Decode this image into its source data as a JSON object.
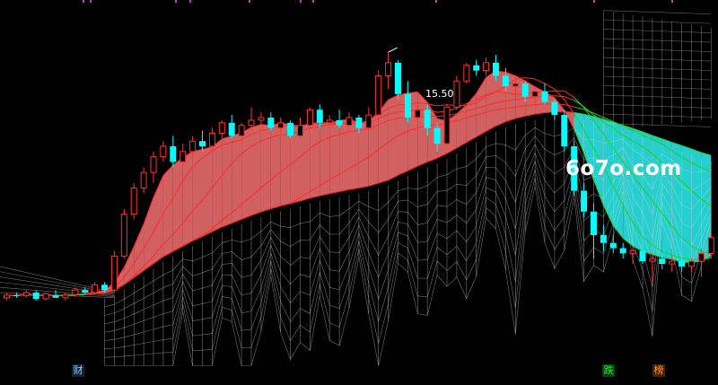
{
  "colors": {
    "background": "#000000",
    "up_candle": "#ff3232",
    "down_candle": "#00ffff",
    "ribbon_up": "#e86a6a",
    "ribbon_down": "#29e6e6",
    "ma_bull": "#ff2a2a",
    "ma_bear": "#1fd11f",
    "mesh": "#d9d9d9"
  },
  "watermark": "6o7o.com",
  "peak_label": "15.50",
  "tags": {
    "cai": "财",
    "die": "跌",
    "bang": "榜"
  },
  "chart_data": {
    "type": "candlestick",
    "title": "",
    "y_scale": {
      "price_at_top": 16.5,
      "price_at_bottom": 9.2
    },
    "annotation": {
      "text": "15.50",
      "index": 39,
      "price": 15.5
    },
    "candles": [
      [
        10.8,
        10.9,
        10.75,
        10.85
      ],
      [
        10.85,
        10.9,
        10.8,
        10.84
      ],
      [
        10.84,
        10.95,
        10.8,
        10.9
      ],
      [
        10.9,
        10.95,
        10.75,
        10.78
      ],
      [
        10.78,
        10.9,
        10.75,
        10.88
      ],
      [
        10.85,
        10.95,
        10.8,
        10.8
      ],
      [
        10.8,
        10.9,
        10.75,
        10.86
      ],
      [
        10.86,
        11.0,
        10.82,
        10.95
      ],
      [
        10.95,
        11.0,
        10.88,
        10.9
      ],
      [
        10.9,
        11.1,
        10.88,
        11.05
      ],
      [
        11.05,
        11.1,
        10.9,
        10.95
      ],
      [
        10.95,
        11.7,
        10.9,
        11.6
      ],
      [
        11.6,
        12.5,
        11.55,
        12.4
      ],
      [
        12.4,
        13.0,
        12.3,
        12.9
      ],
      [
        12.9,
        13.3,
        12.8,
        13.2
      ],
      [
        13.2,
        13.6,
        13.0,
        13.5
      ],
      [
        13.5,
        13.8,
        13.4,
        13.7
      ],
      [
        13.7,
        13.9,
        13.3,
        13.4
      ],
      [
        13.4,
        13.75,
        13.3,
        13.6
      ],
      [
        13.6,
        13.9,
        13.5,
        13.8
      ],
      [
        13.8,
        14.0,
        13.6,
        13.7
      ],
      [
        13.7,
        14.05,
        13.6,
        13.95
      ],
      [
        13.95,
        14.2,
        13.85,
        14.15
      ],
      [
        14.15,
        14.3,
        13.85,
        13.9
      ],
      [
        13.9,
        14.15,
        13.8,
        14.1
      ],
      [
        14.1,
        14.45,
        14.0,
        14.2
      ],
      [
        14.2,
        14.35,
        14.05,
        14.25
      ],
      [
        14.25,
        14.35,
        14.0,
        14.05
      ],
      [
        14.05,
        14.25,
        13.95,
        14.15
      ],
      [
        14.15,
        14.2,
        13.85,
        13.9
      ],
      [
        13.9,
        14.25,
        13.85,
        14.1
      ],
      [
        14.1,
        14.45,
        14.05,
        14.4
      ],
      [
        14.4,
        14.5,
        14.05,
        14.15
      ],
      [
        14.15,
        14.3,
        14.0,
        14.2
      ],
      [
        14.2,
        14.4,
        14.05,
        14.1
      ],
      [
        14.1,
        14.35,
        14.0,
        14.25
      ],
      [
        14.25,
        14.3,
        13.95,
        14.05
      ],
      [
        14.05,
        14.45,
        14.0,
        14.3
      ],
      [
        14.3,
        15.15,
        14.2,
        15.05
      ],
      [
        15.05,
        15.5,
        14.8,
        15.3
      ],
      [
        15.3,
        15.35,
        14.6,
        14.7
      ],
      [
        14.7,
        14.95,
        14.15,
        14.25
      ],
      [
        14.25,
        14.55,
        14.0,
        14.4
      ],
      [
        14.4,
        14.5,
        13.9,
        14.05
      ],
      [
        14.05,
        14.15,
        13.6,
        13.75
      ],
      [
        13.75,
        14.5,
        13.7,
        14.45
      ],
      [
        14.45,
        15.05,
        14.4,
        14.95
      ],
      [
        14.95,
        15.3,
        14.9,
        15.25
      ],
      [
        15.25,
        15.35,
        15.05,
        15.15
      ],
      [
        15.15,
        15.4,
        15.05,
        15.3
      ],
      [
        15.3,
        15.45,
        14.95,
        15.05
      ],
      [
        15.05,
        15.2,
        14.75,
        14.85
      ],
      [
        14.85,
        15.0,
        14.7,
        14.9
      ],
      [
        14.9,
        14.95,
        14.55,
        14.65
      ],
      [
        14.65,
        14.85,
        14.5,
        14.75
      ],
      [
        14.75,
        14.9,
        14.5,
        14.55
      ],
      [
        14.55,
        14.6,
        14.2,
        14.3
      ],
      [
        14.3,
        14.4,
        13.6,
        13.7
      ],
      [
        13.7,
        13.8,
        12.75,
        12.85
      ],
      [
        12.85,
        13.0,
        12.35,
        12.45
      ],
      [
        12.45,
        12.6,
        11.55,
        12.0
      ],
      [
        12.0,
        12.2,
        11.7,
        11.85
      ],
      [
        11.85,
        12.0,
        11.65,
        11.75
      ],
      [
        11.75,
        11.85,
        11.55,
        11.65
      ],
      [
        11.65,
        11.8,
        11.45,
        11.7
      ],
      [
        11.7,
        11.8,
        11.45,
        11.5
      ],
      [
        11.5,
        11.65,
        11.1,
        11.55
      ],
      [
        11.55,
        11.65,
        11.35,
        11.45
      ],
      [
        11.45,
        11.6,
        11.3,
        11.5
      ],
      [
        11.5,
        11.6,
        11.3,
        11.4
      ],
      [
        11.4,
        11.55,
        11.3,
        11.5
      ],
      [
        11.5,
        11.75,
        11.2,
        11.65
      ],
      [
        11.65,
        12.05,
        11.55,
        11.95
      ]
    ]
  }
}
